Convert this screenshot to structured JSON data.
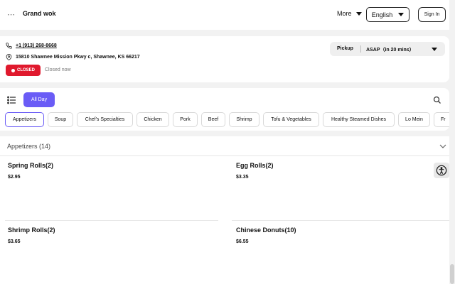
{
  "header": {
    "brand": "Grand wok",
    "more_label": "More",
    "language": "English",
    "signin_label": "Sign In"
  },
  "info": {
    "phone": "+1 (913) 268-8668",
    "address": "15810 Shawnee Mission Pkwy c, Shawnee, KS 66217",
    "status_badge": "CLOSED",
    "status_text": "Closed now",
    "pickup_label": "Pickup",
    "pickup_time": "ASAP（in 20 mins）"
  },
  "menu": {
    "daypart": "All Day",
    "categories": [
      "Appetizers",
      "Soup",
      "Chef's Specialties",
      "Chicken",
      "Pork",
      "Beef",
      "Shrimp",
      "Tofu & Vegetables",
      "Healthy Steamed Dishes",
      "Lo Mein",
      "Fr"
    ],
    "active_category": "Appetizers"
  },
  "section": {
    "title": "Appetizers (14)",
    "items": [
      {
        "name": "Spring Rolls(2)",
        "price": "$2.95"
      },
      {
        "name": "Egg Rolls(2)",
        "price": "$3.35"
      },
      {
        "name": "Shrimp Rolls(2)",
        "price": "$3.65"
      },
      {
        "name": "Chinese Donuts(10)",
        "price": "$6.55"
      }
    ]
  },
  "colors": {
    "accent": "#6a5cf6",
    "closed_red": "#e0192d"
  },
  "icons": [
    "menu-dots-icon",
    "caret-down-icon",
    "phone-icon",
    "location-pin-icon",
    "list-icon",
    "search-icon",
    "chevron-down-icon",
    "accessibility-icon"
  ]
}
